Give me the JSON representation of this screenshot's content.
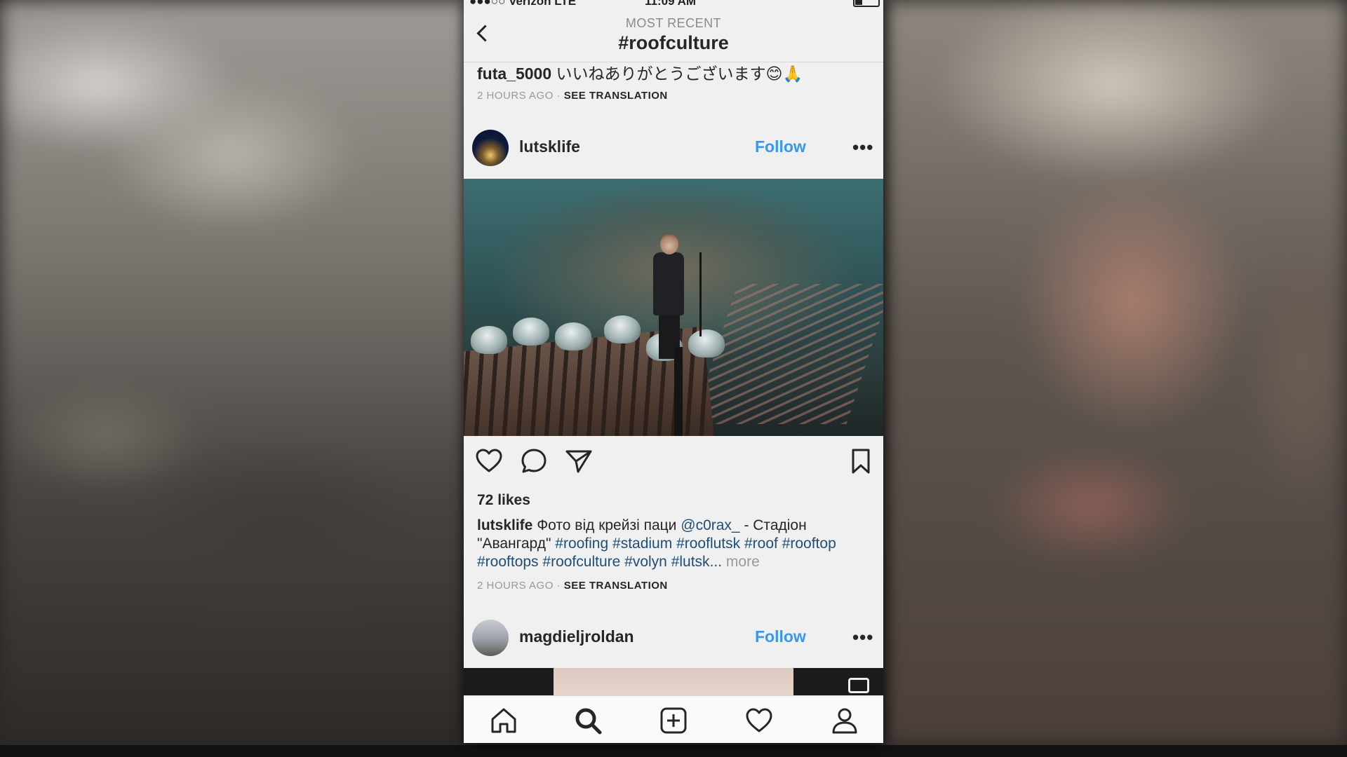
{
  "status_bar": {
    "carrier": "●●●○○ Verizon  LTE",
    "time": "11:09 AM"
  },
  "nav": {
    "subtitle": "MOST RECENT",
    "title": "#roofculture"
  },
  "previous_post": {
    "user": "futa_5000",
    "caption": "いいねありがとうございます😊🙏",
    "time": "2 HOURS AGO",
    "separator": " · ",
    "see_translation": "SEE TRANSLATION"
  },
  "post": {
    "user": "lutsklife",
    "follow": "Follow",
    "more": "•••",
    "likes": "72 likes",
    "caption_user": "lutsklife",
    "caption_text": "Фото від крейзі паци ",
    "mention": "@c0rax_",
    "caption_text2": " -  Стадіон \"Авангард\" ",
    "hashtags": [
      "#roofing",
      "#stadium",
      "#rooflutsk",
      "#roof",
      "#rooftop",
      "#rooftops",
      "#roofculture",
      "#volyn",
      "#lutsk..."
    ],
    "more_label": "more",
    "time": "2 HOURS AGO",
    "separator": " · ",
    "see_translation": "SEE TRANSLATION"
  },
  "next_post": {
    "user": "magdieljroldan",
    "follow": "Follow",
    "more": "•••"
  },
  "icons": {
    "back": "chevron-left-icon",
    "like": "heart-icon",
    "comment": "comment-icon",
    "share": "send-icon",
    "save": "bookmark-icon",
    "tabs": [
      "home-icon",
      "search-icon",
      "add-icon",
      "activity-heart-icon",
      "profile-icon"
    ]
  },
  "colors": {
    "follow_blue": "#3897f0",
    "hashtag": "#1f4d78"
  }
}
